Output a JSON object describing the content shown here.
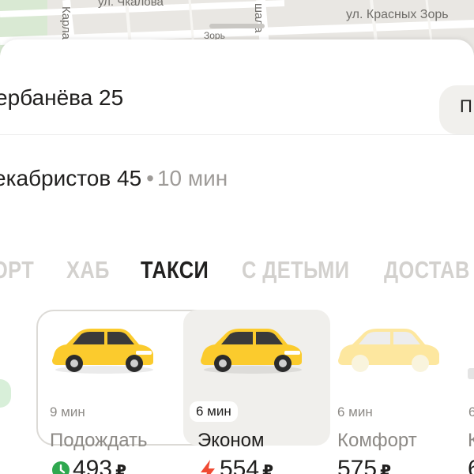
{
  "map": {
    "streets": {
      "chkalova": "ул. Чкалова",
      "krasnyh_zor": "ул. Красных Зорь",
      "zor_lower": "Зорь",
      "karl": "Карла",
      "shala": "шала"
    }
  },
  "route": {
    "from": "ербанёва 25",
    "entrance_label": "П",
    "to": "екабристов 45",
    "to_separator": "•",
    "to_eta": "10 мин"
  },
  "tabs": [
    {
      "label": "ОРТ",
      "active": false
    },
    {
      "label": "ХАБ",
      "active": false
    },
    {
      "label": "ТАКСИ",
      "active": true
    },
    {
      "label": "С ДЕТЬМИ",
      "active": false
    },
    {
      "label": "ДОСТАВ",
      "active": false
    }
  ],
  "tariffs": [
    {
      "name": "Подождать",
      "eta": "9 мин",
      "price": "493",
      "currency": "₽",
      "icon": "clock-icon"
    },
    {
      "name": "Эконом",
      "eta": "6 мин",
      "price": "554",
      "currency": "₽",
      "icon": "lightning-icon",
      "selected": true
    },
    {
      "name": "Комфорт",
      "eta": "6 мин",
      "price": "575",
      "currency": "₽"
    },
    {
      "name": "К",
      "eta": "6",
      "price": "6"
    }
  ],
  "colors": {
    "taxi_yellow": "#fbcb2d",
    "text_primary": "#21201f",
    "text_secondary": "#8d8a86",
    "tab_inactive": "#d3d1ce",
    "clock_green": "#2fa84f",
    "lightning_red": "#f04a33"
  }
}
